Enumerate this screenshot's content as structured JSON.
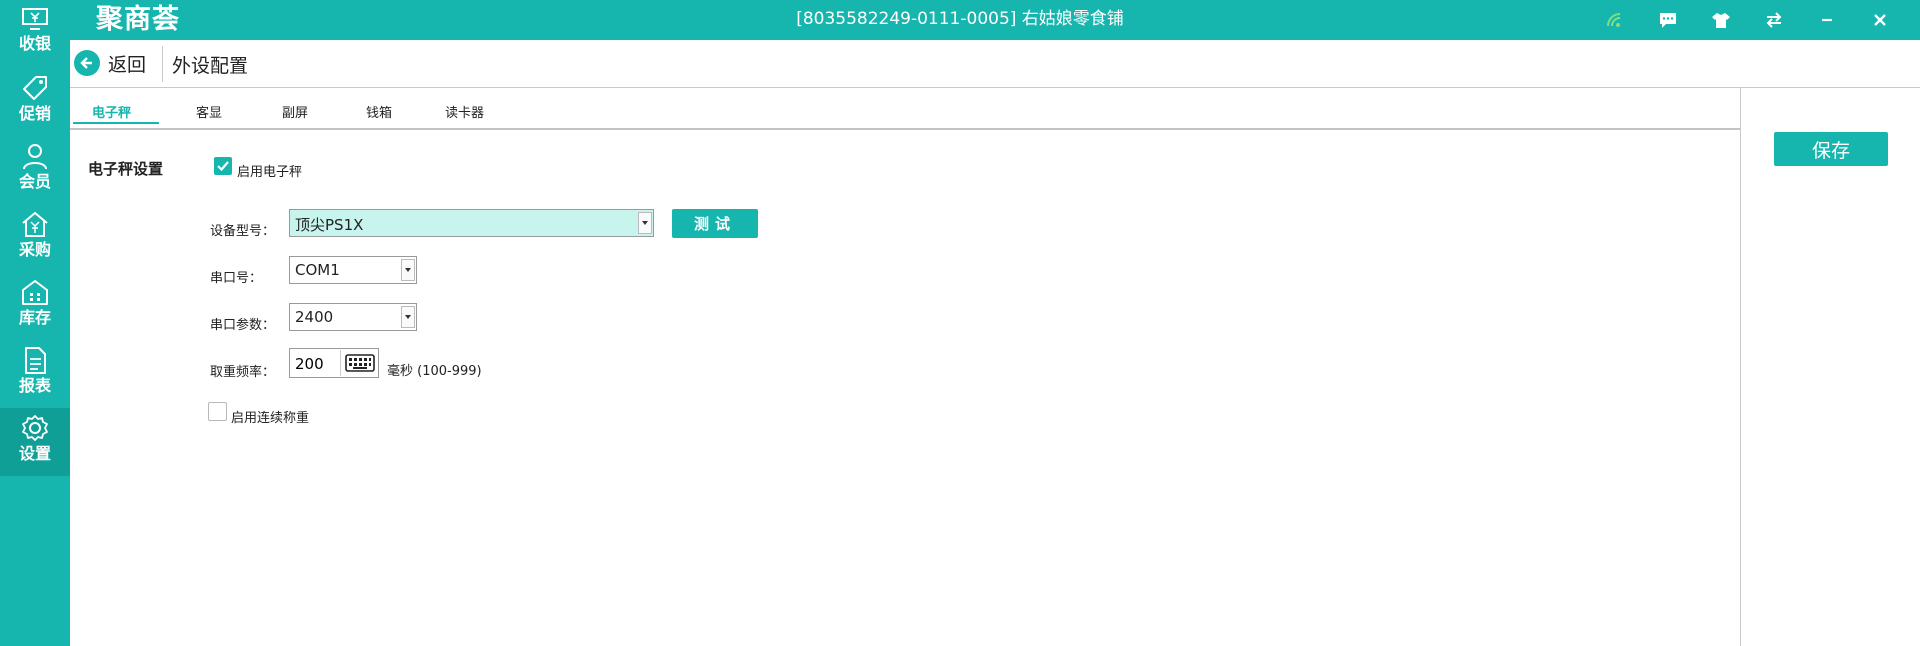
{
  "app": {
    "logo": "聚商荟",
    "store_title": "[8035582249-0111-0005] 右姑娘零食铺"
  },
  "titlebar": {
    "icons": [
      "wifi-icon",
      "message-icon",
      "shirt-icon",
      "switch-icon",
      "minimize-icon",
      "close-icon"
    ]
  },
  "sidebar": {
    "items": [
      {
        "label": "收银",
        "icon": "cashier-icon"
      },
      {
        "label": "促销",
        "icon": "tag-icon"
      },
      {
        "label": "会员",
        "icon": "user-icon"
      },
      {
        "label": "采购",
        "icon": "purchase-icon"
      },
      {
        "label": "库存",
        "icon": "warehouse-icon"
      },
      {
        "label": "报表",
        "icon": "report-icon"
      },
      {
        "label": "设置",
        "icon": "gear-icon"
      }
    ],
    "active": "设置"
  },
  "header": {
    "back_label": "返回",
    "title": "外设配置"
  },
  "tabs": [
    {
      "label": "电子秤",
      "active": true
    },
    {
      "label": "客显"
    },
    {
      "label": "副屏"
    },
    {
      "label": "钱箱"
    },
    {
      "label": "读卡器"
    }
  ],
  "scale": {
    "section_title": "电子秤设置",
    "enable_label": "启用电子秤",
    "enable_checked": true,
    "model_label": "设备型号：",
    "model_value": "顶尖PS1X",
    "test_label": "测试",
    "port_label": "串口号：",
    "port_value": "COM1",
    "param_label": "串口参数：",
    "param_value": "2400",
    "freq_label": "取重频率：",
    "freq_value": "200",
    "freq_unit": "毫秒 (100-999)",
    "continuous_label": "启用连续称重",
    "continuous_checked": false
  },
  "actions": {
    "save_label": "保存"
  },
  "colors": {
    "accent": "#16b5ad",
    "active_sidebar": "#0f9f97",
    "select_highlight": "#c8f4ee"
  }
}
